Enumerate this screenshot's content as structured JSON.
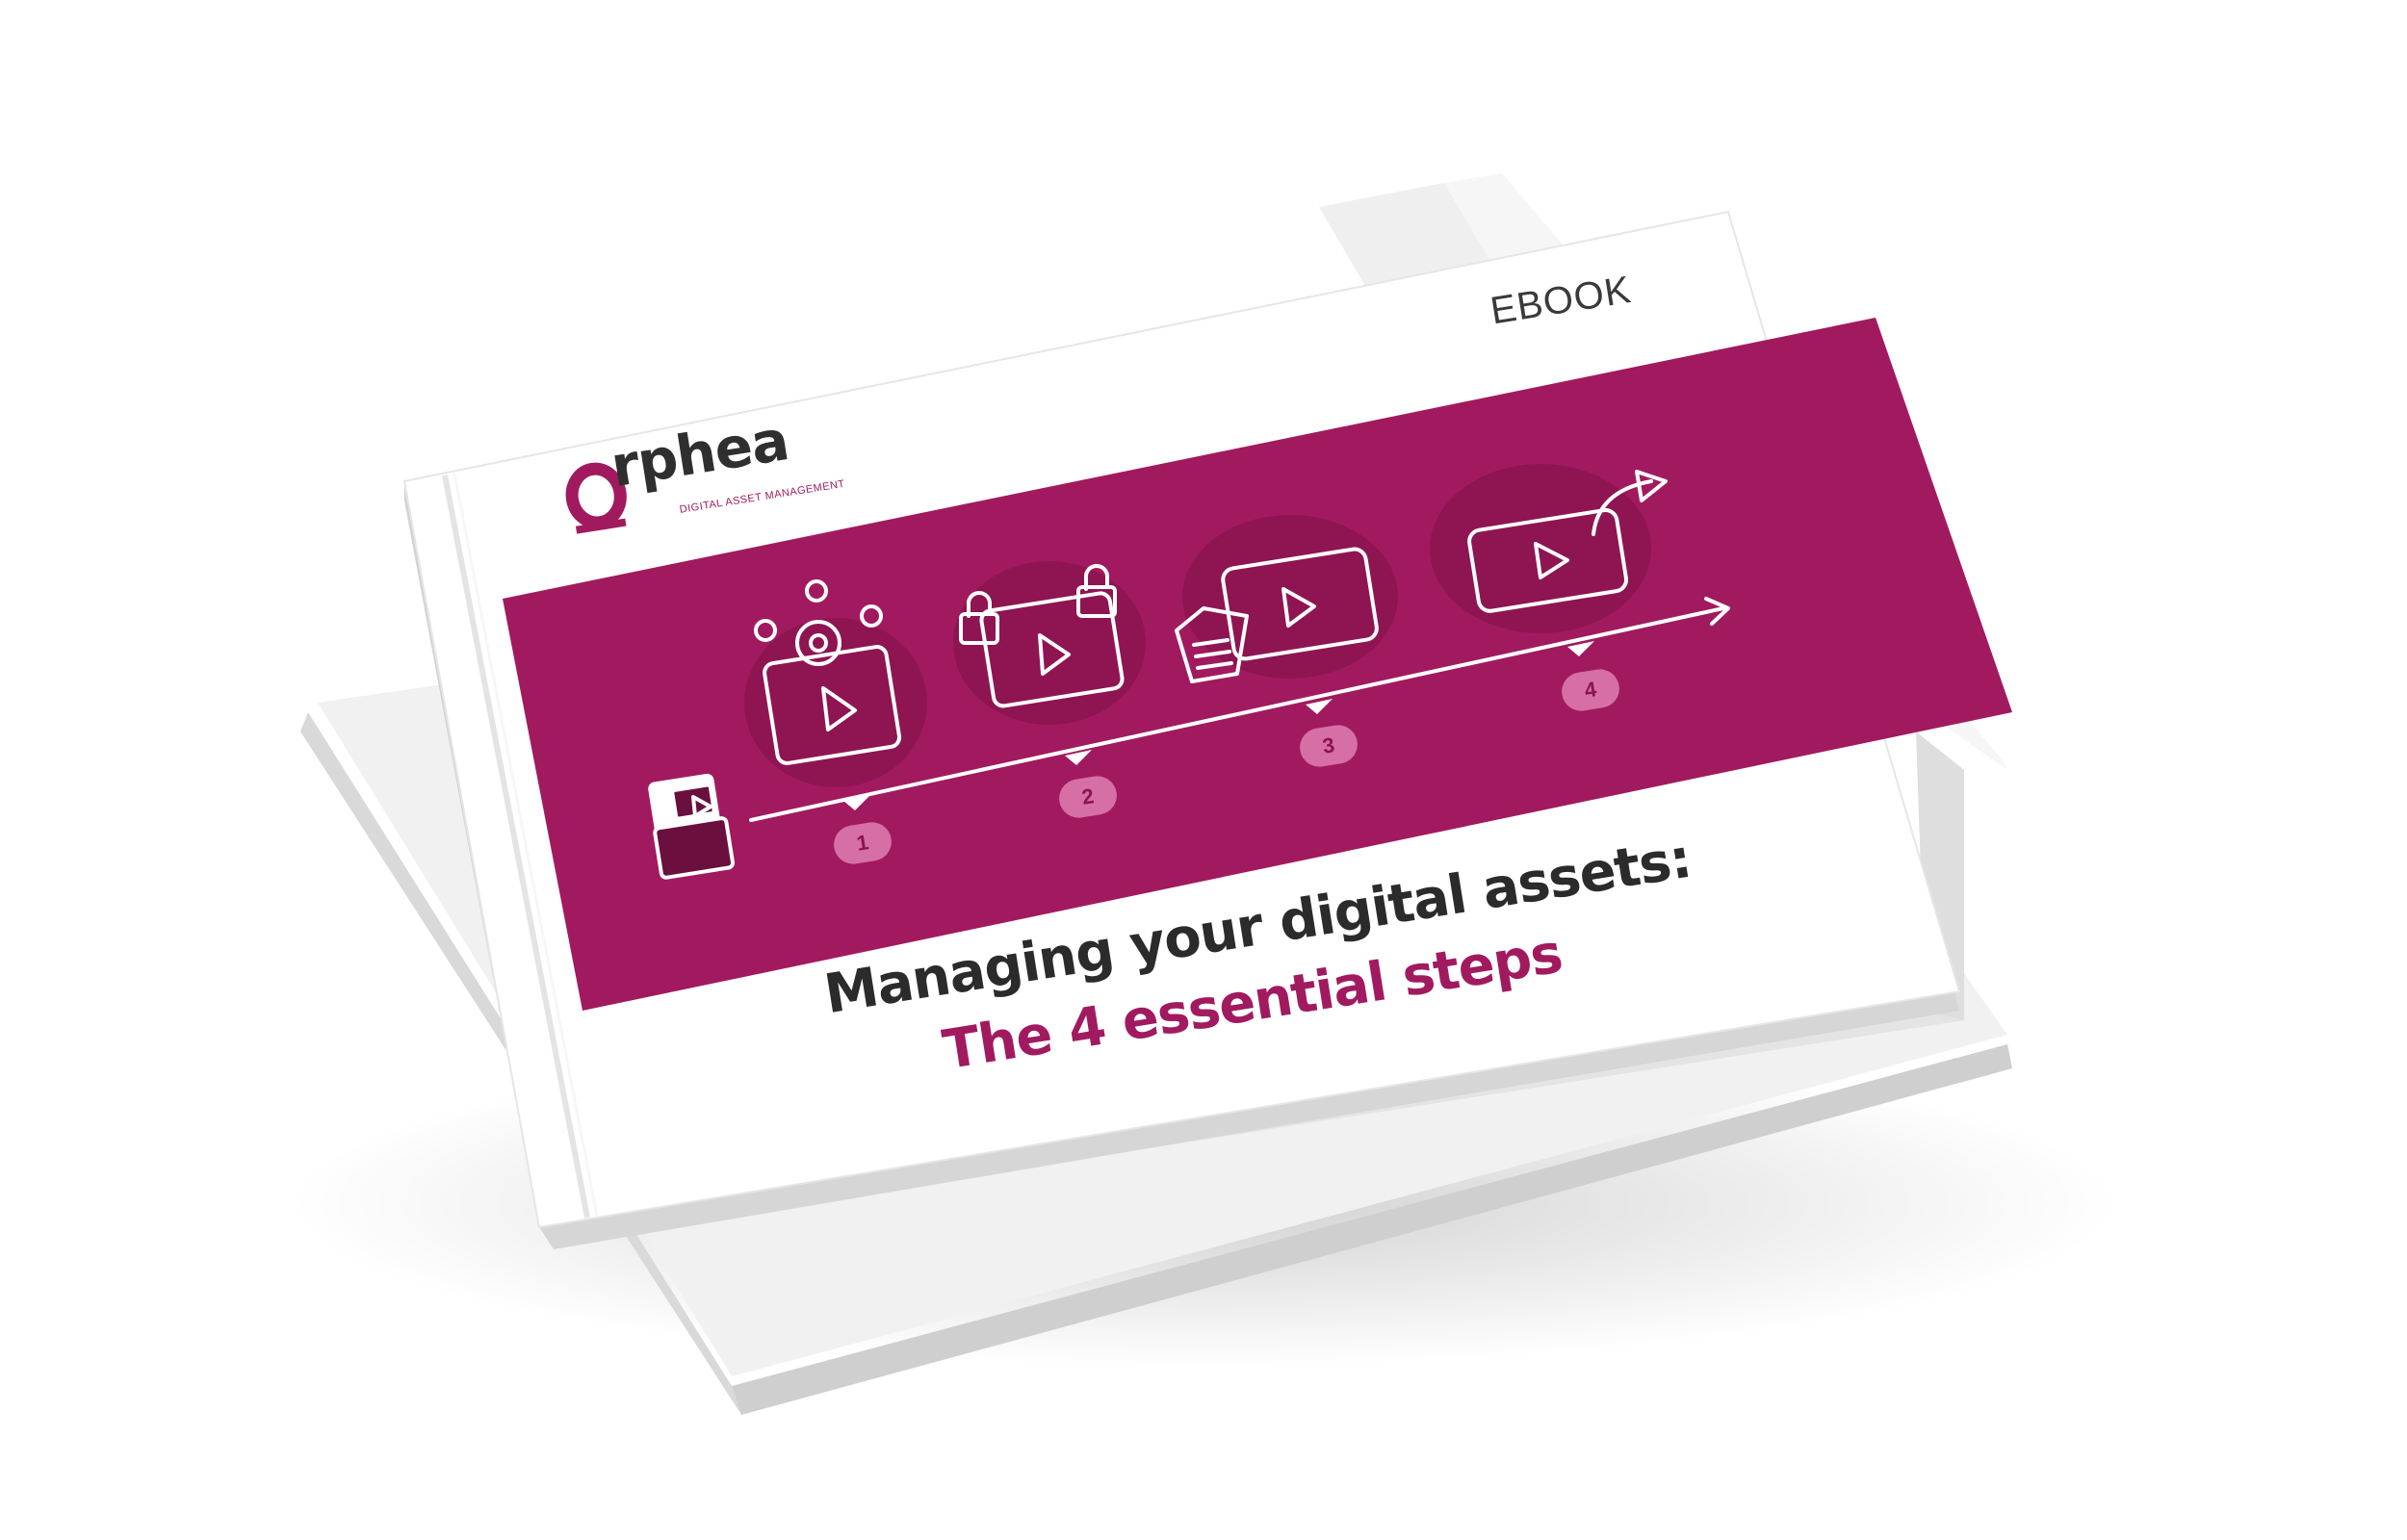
{
  "cover": {
    "ebook_label": "EBOOK",
    "brand": "Orphea",
    "brand_word_rest": "rphea",
    "brand_tagline": "DIGITAL ASSET MANAGEMENT",
    "title_line1": "Managing your digital assets:",
    "title_line2": "The 4 essential steps",
    "steps": [
      "1",
      "2",
      "3",
      "4"
    ]
  },
  "colors": {
    "accent": "#a11a5f",
    "accent_dark": "#8a1450",
    "accent_light": "#d66fa6",
    "cover_white": "#ffffff",
    "text_dark": "#2b2b2b"
  },
  "icons": [
    "folder-video-icon",
    "collaboration-gear-video-icon",
    "lock-video-icon",
    "tag-video-icon",
    "share-arrow-video-icon"
  ]
}
